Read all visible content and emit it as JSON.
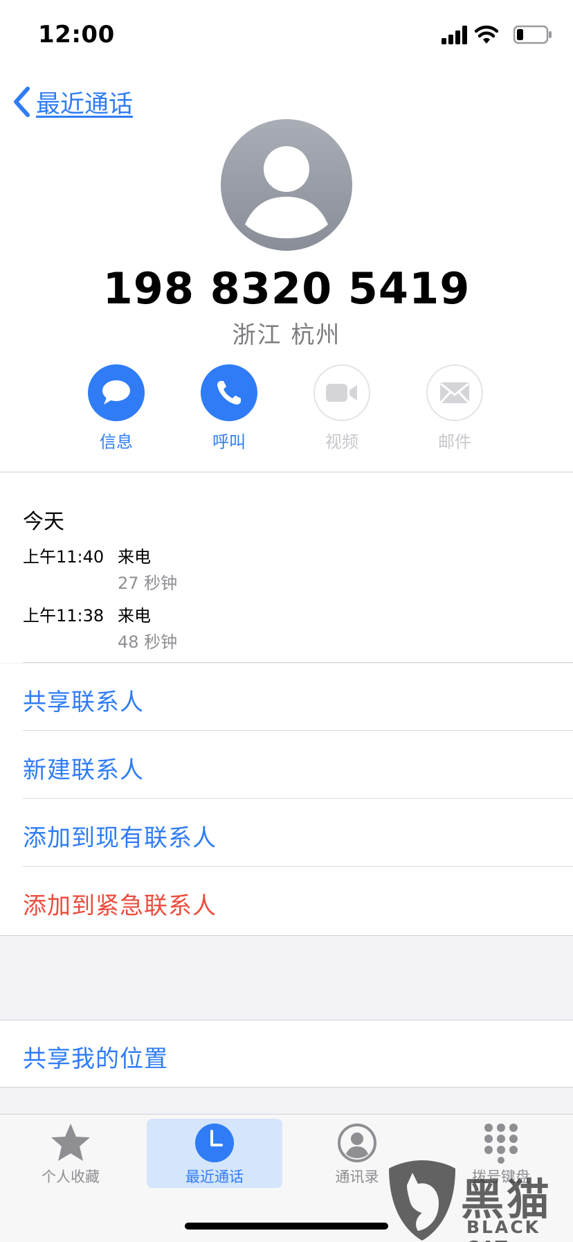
{
  "status_bar": {
    "time": "12:00",
    "icons": [
      "signal-icon",
      "wifi-icon",
      "battery-icon"
    ]
  },
  "nav": {
    "back_label": "最近通话"
  },
  "contact": {
    "phone_number": "198 8320 5419",
    "location": "浙江 杭州"
  },
  "actions": [
    {
      "label": "信息",
      "icon": "message-icon",
      "enabled": true
    },
    {
      "label": "呼叫",
      "icon": "phone-icon",
      "enabled": true
    },
    {
      "label": "视频",
      "icon": "video-icon",
      "enabled": false
    },
    {
      "label": "邮件",
      "icon": "mail-icon",
      "enabled": false
    }
  ],
  "recent_calls": {
    "day": "今天",
    "items": [
      {
        "time": "上午11:40",
        "type": "来电",
        "duration": "27 秒钟"
      },
      {
        "time": "上午11:38",
        "type": "来电",
        "duration": "48 秒钟"
      }
    ]
  },
  "options": [
    {
      "label": "共享联系人"
    },
    {
      "label": "新建联系人"
    },
    {
      "label": "添加到现有联系人"
    },
    {
      "label": "添加到紧急联系人",
      "destructive": true
    }
  ],
  "share_location": {
    "label": "共享我的位置"
  },
  "tabs": [
    {
      "label": "个人收藏",
      "icon": "star-icon",
      "active": false
    },
    {
      "label": "最近通话",
      "icon": "clock-icon",
      "active": true
    },
    {
      "label": "通讯录",
      "icon": "contacts-icon",
      "active": false
    },
    {
      "label": "拨号键盘",
      "icon": "keypad-icon",
      "active": false
    }
  ],
  "watermark": {
    "chars": "黑猫",
    "latin": "BLACK CAT"
  },
  "colors": {
    "accent": "#2f7cf6",
    "destructive": "#eb4d3d",
    "secondary_text": "#8e8e93",
    "background": "#f2f2f7"
  }
}
